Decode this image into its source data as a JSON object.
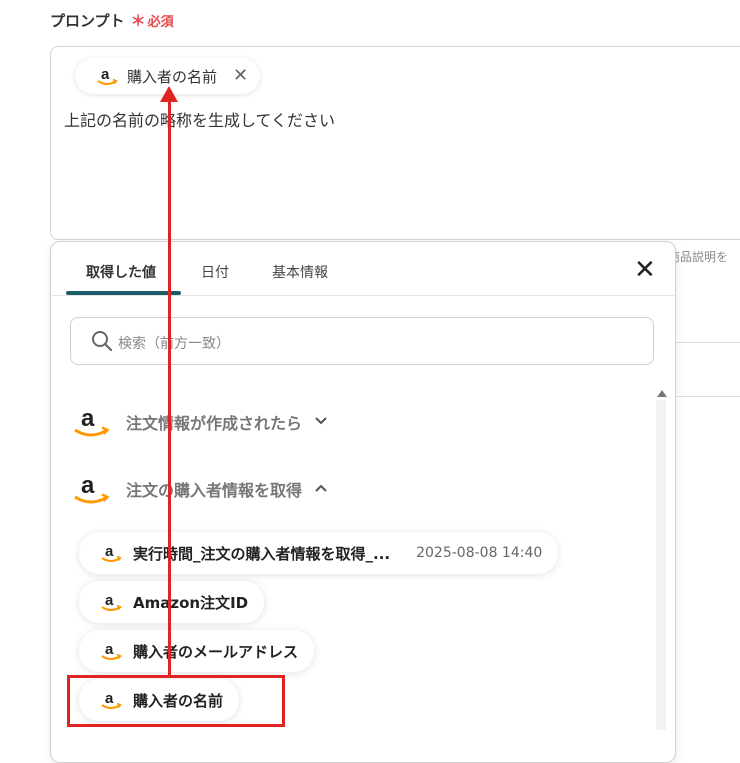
{
  "prompt": {
    "label": "プロンプト",
    "required_mark": "＊",
    "required_text": "必須",
    "chip_label": "購入者の名前",
    "text": "上記の名前の略称を生成してください"
  },
  "background_hint": "商品説明を",
  "panel": {
    "tabs": [
      {
        "label": "取得した値",
        "active": true
      },
      {
        "label": "日付",
        "active": false
      },
      {
        "label": "基本情報",
        "active": false
      }
    ],
    "search_placeholder": "検索（前方一致）",
    "groups": [
      {
        "label": "注文情報が作成されたら",
        "expanded": false
      },
      {
        "label": "注文の購入者情報を取得",
        "expanded": true
      }
    ],
    "items": [
      {
        "label": "実行時間_注文の購入者情報を取得_...",
        "date": "2025-08-08 14:40"
      },
      {
        "label": "Amazon注文ID"
      },
      {
        "label": "購入者のメールアドレス"
      },
      {
        "label": "購入者の名前"
      }
    ]
  },
  "icons": {
    "amazon": "amazon-logo-icon",
    "search": "search-icon",
    "close": "close-icon",
    "chevron_down": "chevron-down-icon",
    "chevron_up": "chevron-up-icon"
  },
  "colors": {
    "accent_tab": "#1c5d6a",
    "required": "#e5484d",
    "annotation": "#e02424",
    "amazon_orange": "#ff9900"
  }
}
